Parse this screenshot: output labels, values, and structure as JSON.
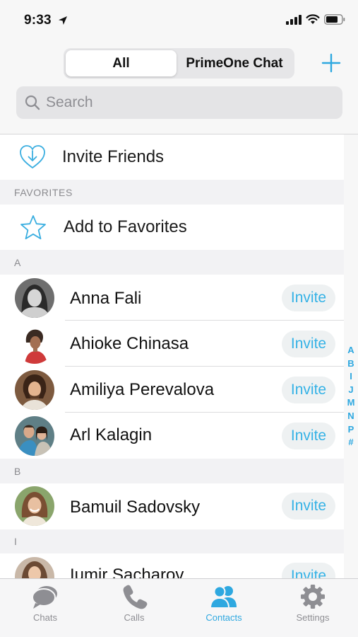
{
  "status_bar": {
    "time": "9:33"
  },
  "header": {
    "segments": [
      "All",
      "PrimeOne Chat"
    ],
    "active_segment": "All"
  },
  "search": {
    "placeholder": "Search"
  },
  "invite_friends": {
    "label": "Invite Friends"
  },
  "favorites": {
    "header": "FAVORITES",
    "add_label": "Add to Favorites"
  },
  "sections": [
    {
      "letter": "A",
      "contacts": [
        {
          "name": "Anna Fali",
          "action": "Invite"
        },
        {
          "name": "Ahioke Chinasa",
          "action": "Invite"
        },
        {
          "name": "Amiliya Perevalova",
          "action": "Invite"
        },
        {
          "name": "Arl Kalagin",
          "action": "Invite"
        }
      ]
    },
    {
      "letter": "B",
      "contacts": [
        {
          "name": "Bamuil Sadovsky",
          "action": "Invite"
        }
      ]
    },
    {
      "letter": "I",
      "contacts": [
        {
          "name": "Iumir Sacharov",
          "action": "Invite"
        }
      ]
    }
  ],
  "index_letters": [
    "A",
    "B",
    "I",
    "J",
    "M",
    "N",
    "P",
    "#"
  ],
  "tabbar": {
    "tabs": [
      {
        "label": "Chats",
        "icon": "chat-bubbles-icon"
      },
      {
        "label": "Calls",
        "icon": "phone-icon"
      },
      {
        "label": "Contacts",
        "icon": "people-icon"
      },
      {
        "label": "Settings",
        "icon": "gear-icon"
      }
    ],
    "active_tab": "Contacts"
  },
  "colors": {
    "accent": "#2ea8e0",
    "invite_bg": "#eef1f2",
    "section_bg": "#f2f2f4"
  }
}
